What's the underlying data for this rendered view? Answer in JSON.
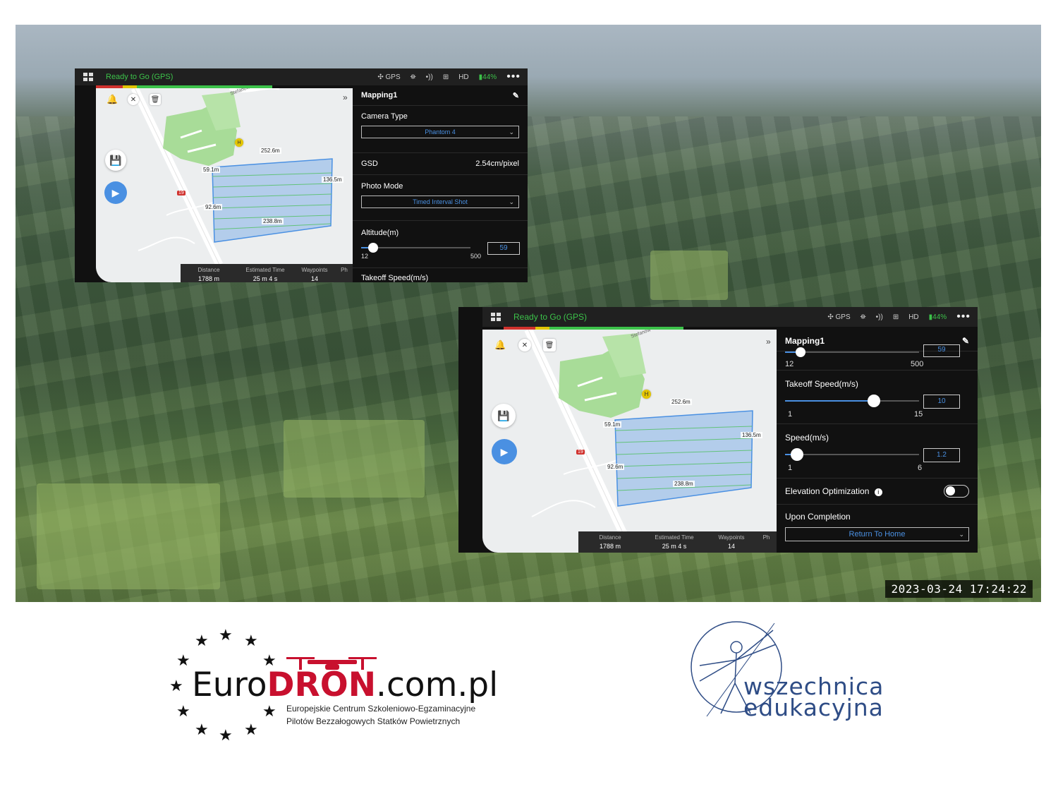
{
  "timestamp": "2023-03-24 17:24:22",
  "panels": [
    {
      "status": "Ready to Go (GPS)",
      "gps_label": "GPS",
      "hd_label": "HD",
      "battery": "44%",
      "progress_label": "--:--",
      "mission_title": "Mapping1",
      "camera_type_label": "Camera Type",
      "camera_type_value": "Phantom 4",
      "gsd_label": "GSD",
      "gsd_value": "2.54cm/pixel",
      "photo_mode_label": "Photo Mode",
      "photo_mode_value": "Timed Interval Shot",
      "altitude_label": "Altitude(m)",
      "altitude_value": "59",
      "altitude_min": "12",
      "altitude_max": "500",
      "next_label": "Takeoff Speed(m/s)",
      "map_labels": {
        "top": "252.6m",
        "left": "59.1m",
        "right": "136.5m",
        "mid": "92.6m",
        "bottom": "238.8m",
        "road": "19",
        "village": "Stefanów"
      },
      "stats": [
        {
          "cap": "Distance",
          "val": "1788 m"
        },
        {
          "cap": "Estimated Time",
          "val": "25 m 4 s"
        },
        {
          "cap": "Waypoints",
          "val": "14"
        },
        {
          "cap": "Ph",
          "val": ""
        }
      ]
    },
    {
      "status": "Ready to Go (GPS)",
      "gps_label": "GPS",
      "hd_label": "HD",
      "battery": "44%",
      "progress_label": "--:--",
      "mission_title": "Mapping1",
      "altitude_value": "59",
      "altitude_min": "12",
      "altitude_max": "500",
      "takeoff_label": "Takeoff Speed(m/s)",
      "takeoff_value": "10",
      "takeoff_min": "1",
      "takeoff_max": "15",
      "speed_label": "Speed(m/s)",
      "speed_value": "1.2",
      "speed_min": "1",
      "speed_max": "6",
      "elevation_label": "Elevation Optimization",
      "elevation_on": false,
      "completion_label": "Upon Completion",
      "completion_value": "Return To Home",
      "map_labels": {
        "top": "252.6m",
        "left": "59.1m",
        "right": "136.5m",
        "mid": "92.6m",
        "bottom": "238.8m",
        "road": "19",
        "village": "Stefanów"
      },
      "stats": [
        {
          "cap": "Distance",
          "val": "1788 m"
        },
        {
          "cap": "Estimated Time",
          "val": "25 m 4 s"
        },
        {
          "cap": "Waypoints",
          "val": "14"
        },
        {
          "cap": "Ph",
          "val": ""
        }
      ]
    }
  ],
  "logo_eurodron": {
    "euro": "Euro",
    "dron": "DRON",
    "domain": ".com.pl",
    "tagline1": "Europejskie Centrum Szkoleniowo-Egzaminacyjne",
    "tagline2": "Pilotów Bezzałogowych Statków Powietrznych"
  },
  "logo_wszechnica": {
    "line1": "wszechnica",
    "line2": "edukacyjna"
  },
  "colors": {
    "status_green": "#3cc24a",
    "accent_blue": "#4a90e2",
    "brand_red": "#c8102e",
    "brand_navy": "#2f4d86"
  }
}
